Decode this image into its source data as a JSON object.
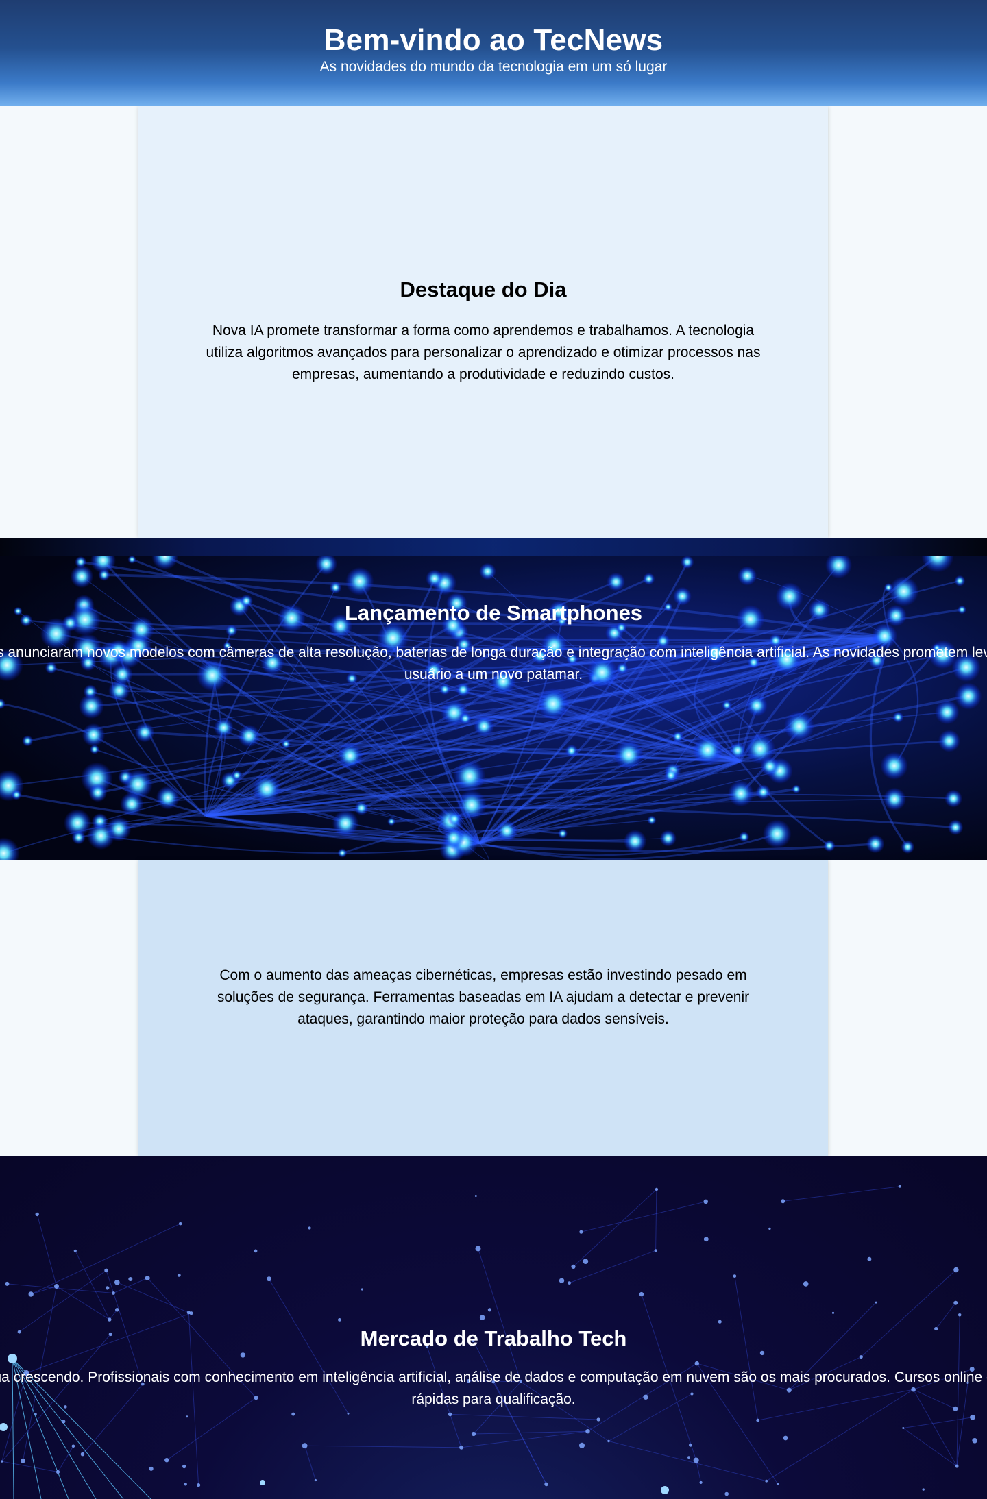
{
  "header": {
    "title": "Bem-vindo ao TecNews",
    "subtitle": "As novidades do mundo da tecnologia em um só lugar"
  },
  "sections": [
    {
      "title": "Destaque do Dia",
      "text": "Nova IA promete transformar a forma como aprendemos e trabalhamos. A tecnologia utiliza algoritmos avançados para personalizar o aprendizado e otimizar processos nas empresas, aumentando a produtividade e reduzindo custos."
    },
    {
      "title": "Lançamento de Smartphones",
      "text": "Grandes fabricantes anunciaram novos modelos com câmeras de alta resolução, baterias de longa duração e integração com inteligência artificial. As novidades prometem levar a experiência do usuário a um novo patamar."
    },
    {
      "title": "",
      "text": "Com o aumento das ameaças cibernéticas, empresas estão investindo pesado em soluções de segurança. Ferramentas baseadas em IA ajudam a detectar e prevenir ataques, garantindo maior proteção para dados sensíveis."
    },
    {
      "title": "Mercado de Trabalho Tech",
      "text": "A demanda por desenvolvedores continua crescendo. Profissionais com conhecimento em inteligência artificial, análise de dados e computação em nuvem são os mais procurados. Cursos online e bootcamps têm se tornado alternativas rápidas para qualificação."
    }
  ],
  "colors": {
    "header_top": "#1f3d71",
    "header_bottom": "#72b0ee",
    "card_light": "#e6f1fb",
    "card_mid": "#cfe3f6",
    "page_bg": "#f4f9fc",
    "fiber_glow": "#4fd4ff",
    "network_bg": "#0c0a3a"
  }
}
